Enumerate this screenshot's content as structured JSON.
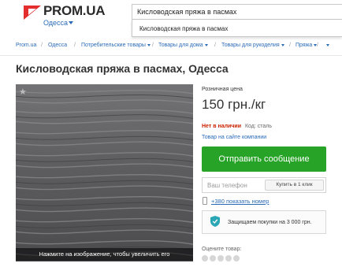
{
  "header": {
    "logo_text": "PROM.UA",
    "city": "Одесса",
    "search_value": "Кисловодская пряжа в пасмах",
    "suggestion": "Кисловодская пряжа в пасмах"
  },
  "breadcrumb": {
    "items": [
      "Prom.ua",
      "Одесса",
      "Потребительские товары",
      "Товары для дома",
      "Товары для рукоделия",
      "Пряжа"
    ]
  },
  "product": {
    "title": "Кисловодская пряжа в пасмах, Одесса",
    "image_hint": "Нажмите на изображение, чтобы увеличить его",
    "price_label": "Розничная цена",
    "price": "150 грн./кг",
    "stock_status": "Нет в наличии",
    "stock_code": "Код: сталь",
    "shop_link": "Товар на сайте компании",
    "send_button": "Отправить сообщение",
    "phone_placeholder": "Ваш телефон",
    "click_buy": "Купить в 1 клик",
    "phone_number": "+380 показать номер",
    "protection": "Защищаем покупки на 3 000 грн.",
    "rate_label": "Оцените товар:"
  },
  "colors": {
    "logo_red": "#e42d2d",
    "link_blue": "#2a6bb8",
    "button_green": "#27a327",
    "status_red": "#cc2200",
    "shield_teal": "#2aa6b4"
  }
}
